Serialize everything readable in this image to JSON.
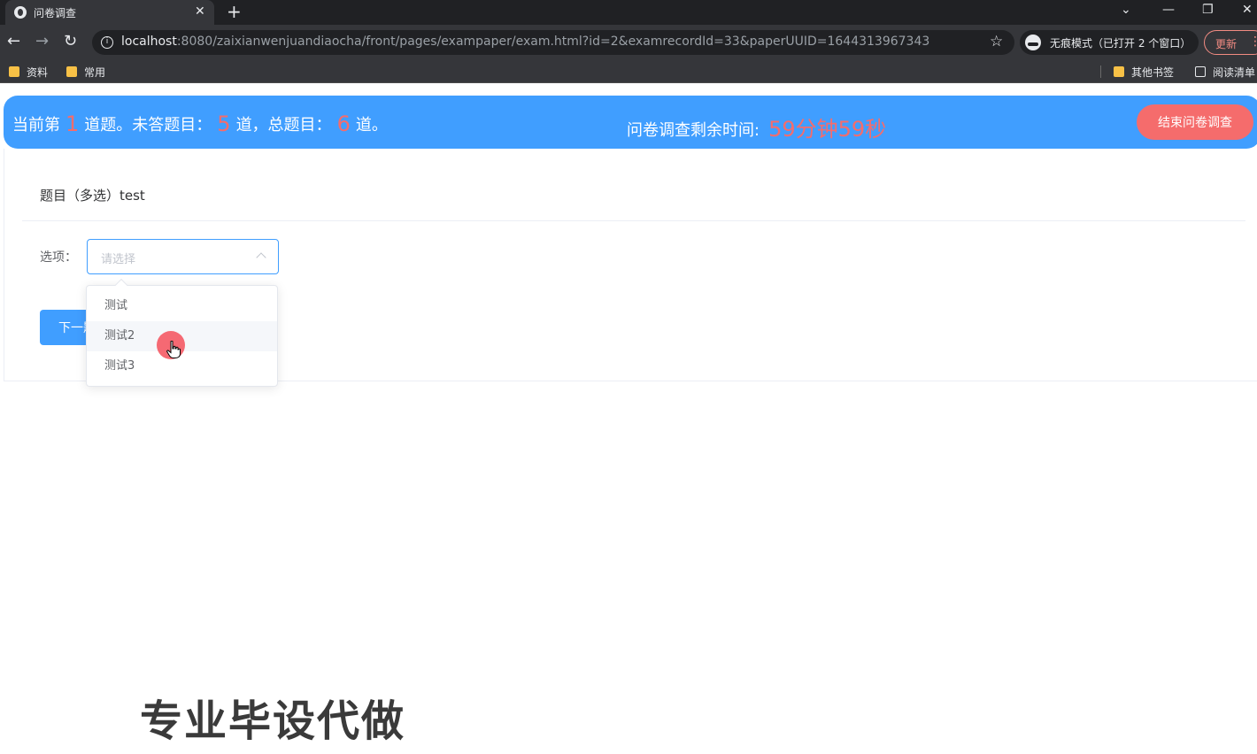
{
  "browser": {
    "tab_title": "问卷调查",
    "tab_close": "✕",
    "new_tab": "+",
    "window_controls": [
      "⌄",
      "—",
      "❐",
      "✕"
    ],
    "nav": {
      "back": "←",
      "forward": "→",
      "reload": "↻"
    },
    "url_host": "localhost",
    "url_rest": ":8080/zaixianwenjuandiaocha/front/pages/exampaper/exam.html?id=2&examrecordId=33&paperUUID=1644313967343",
    "incognito_text": "无痕模式（已打开 2 个窗口）",
    "update_label": "更新",
    "bookmarks": [
      "资料",
      "常用"
    ],
    "bookmarks_right": [
      "其他书签",
      "阅读清单"
    ]
  },
  "header": {
    "current_prefix": "当前第",
    "current_num": "1",
    "current_suffix": "道题。未答题目：",
    "unanswered_num": "5",
    "total_prefix": "道，总题目：",
    "total_num": "6",
    "total_suffix": "道。",
    "time_label": "问卷调查剩余时间:",
    "time_value": "59分钟59秒",
    "end_button": "结束问卷调查"
  },
  "question": {
    "title": "题目（多选）test",
    "option_label": "选项：",
    "select_placeholder": "请选择",
    "options": [
      "测试",
      "测试2",
      "测试3"
    ],
    "hovered_option": "测试2",
    "next_button": "下一题"
  },
  "colors": {
    "primary": "#409eff",
    "danger": "#f56c6c"
  },
  "watermark": "专业毕设代做"
}
